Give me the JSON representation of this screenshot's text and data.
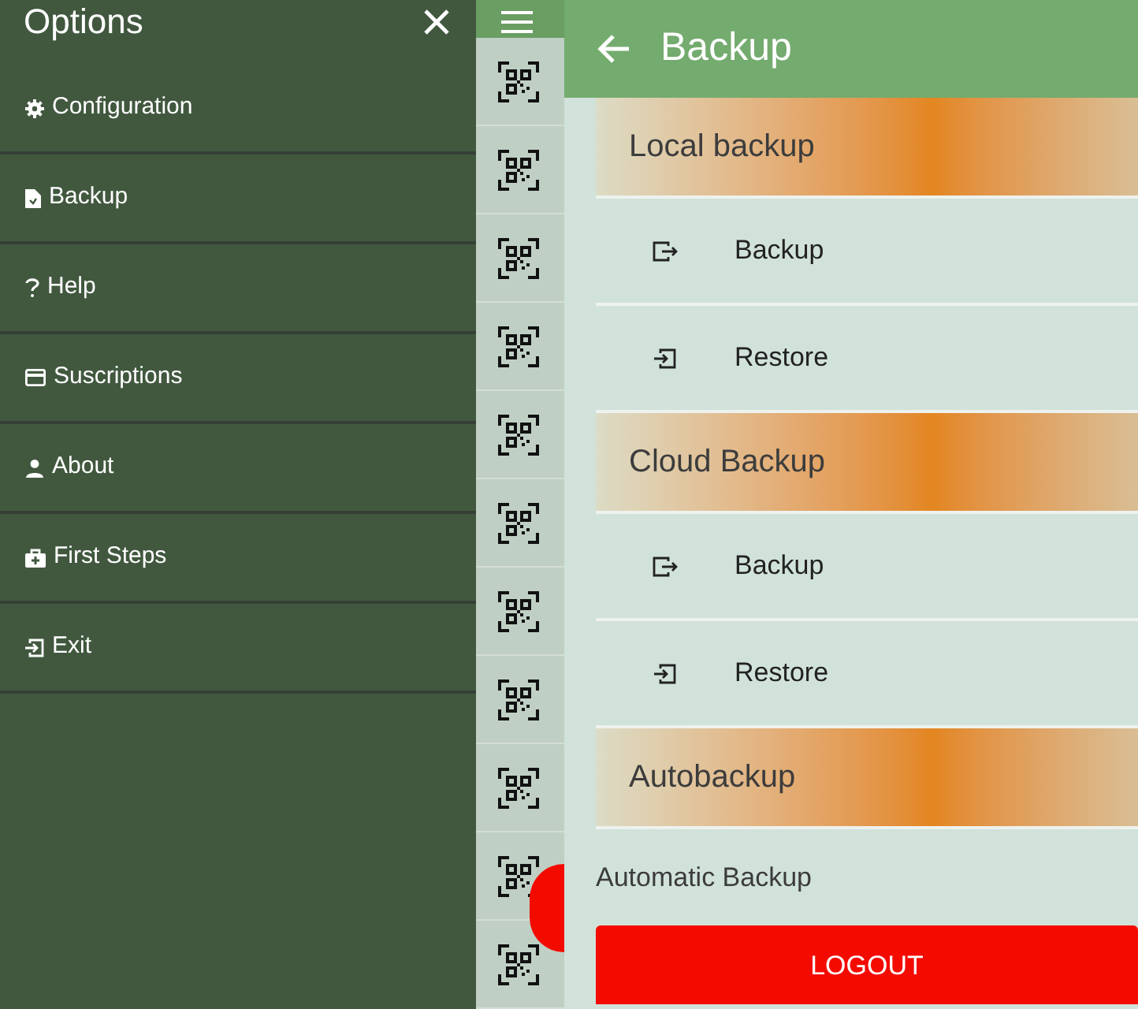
{
  "drawer": {
    "title": "Options",
    "items": [
      {
        "label": "Configuration"
      },
      {
        "label": "Backup"
      },
      {
        "label": "Help"
      },
      {
        "label": "Suscriptions"
      },
      {
        "label": "About"
      },
      {
        "label": "First Steps"
      },
      {
        "label": "Exit"
      }
    ]
  },
  "backup_screen": {
    "title": "Backup",
    "sections": [
      {
        "title": "Local backup",
        "items": [
          {
            "label": "Backup",
            "kind": "backup"
          },
          {
            "label": "Restore",
            "kind": "restore"
          }
        ]
      },
      {
        "title": "Cloud Backup",
        "items": [
          {
            "label": "Backup",
            "kind": "backup"
          },
          {
            "label": "Restore",
            "kind": "restore"
          }
        ]
      },
      {
        "title": "Autobackup"
      }
    ],
    "automatic_backup_label": "Automatic Backup",
    "logout_button": "LOGOUT"
  }
}
